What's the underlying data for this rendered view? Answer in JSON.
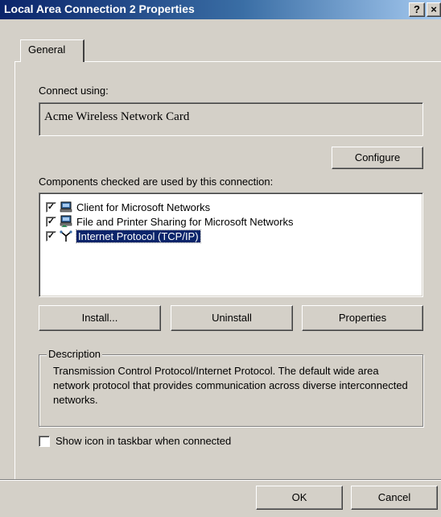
{
  "window": {
    "title": "Local Area Connection 2 Properties",
    "help_button": "?",
    "close_button": "×"
  },
  "tabs": [
    {
      "label": "General",
      "active": true
    }
  ],
  "connect_using": {
    "label": "Connect using:",
    "value": "Acme Wireless Network Card",
    "configure_button": "Configure"
  },
  "components": {
    "label": "Components checked are used by this connection:",
    "items": [
      {
        "label": "Client for Microsoft Networks",
        "checked": true,
        "icon": "network-client-icon",
        "selected": false
      },
      {
        "label": "File and Printer Sharing for Microsoft Networks",
        "checked": true,
        "icon": "file-printer-sharing-icon",
        "selected": false
      },
      {
        "label": "Internet Protocol (TCP/IP)",
        "checked": true,
        "icon": "protocol-icon",
        "selected": true
      }
    ]
  },
  "buttons": {
    "install": "Install...",
    "uninstall": "Uninstall",
    "properties": "Properties"
  },
  "description": {
    "legend": "Description",
    "text": "Transmission Control Protocol/Internet Protocol. The default wide area network protocol that provides communication across diverse interconnected networks."
  },
  "show_icon": {
    "label": "Show icon in taskbar when connected",
    "checked": false
  },
  "footer": {
    "ok": "OK",
    "cancel": "Cancel"
  },
  "colors": {
    "face": "#d4d0c8",
    "titlebar_start": "#0a246a",
    "titlebar_end": "#a6caf0",
    "selection": "#0a246a"
  }
}
